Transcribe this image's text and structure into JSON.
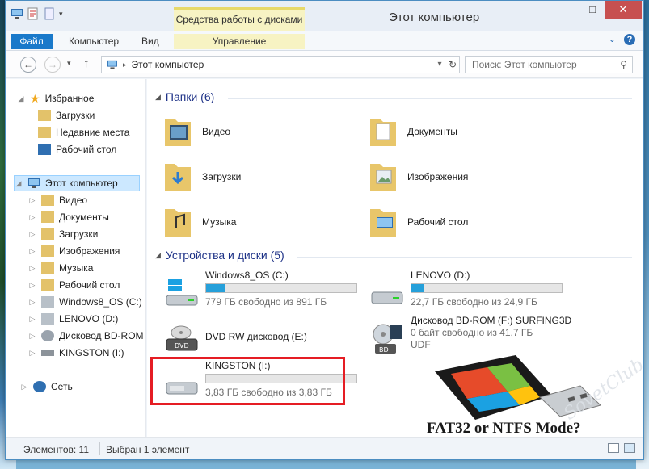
{
  "window": {
    "title": "Этот компьютер",
    "tools_tab_header": "Средства работы с дисками",
    "controls": [
      "—",
      "□",
      "✕"
    ]
  },
  "ribbon": {
    "tabs": [
      "Файл",
      "Компьютер",
      "Вид",
      "Управление"
    ]
  },
  "address": {
    "path": "Этот компьютер",
    "search_placeholder": "Поиск: Этот компьютер"
  },
  "nav_pane": {
    "favorites_label": "Избранное",
    "favorites": [
      "Загрузки",
      "Недавние места",
      "Рабочий стол"
    ],
    "computer_label": "Этот компьютер",
    "computer_items": [
      "Видео",
      "Документы",
      "Загрузки",
      "Изображения",
      "Музыка",
      "Рабочий стол",
      "Windows8_OS (C:)",
      "LENOVO (D:)",
      "Дисковод BD-ROM",
      "KINGSTON (I:)"
    ],
    "network_label": "Сеть"
  },
  "content": {
    "folders_header": "Папки (6)",
    "folders": [
      "Видео",
      "Документы",
      "Загрузки",
      "Изображения",
      "Музыка",
      "Рабочий стол"
    ],
    "devices_header": "Устройства и диски (5)",
    "drives": [
      {
        "name": "Windows8_OS (C:)",
        "info": "779 ГБ свободно из 891 ГБ",
        "used_fraction": 0.126
      },
      {
        "name": "LENOVO (D:)",
        "info": "22,7 ГБ свободно из 24,9 ГБ",
        "used_fraction": 0.088
      },
      {
        "name": "DVD RW дисковод (E:)",
        "info": "",
        "used_fraction": null
      },
      {
        "name": "Дисковод BD-ROM (F:) SURFING3D",
        "info": "0 байт свободно из 41,7 ГБ",
        "info2": "UDF",
        "used_fraction": null
      },
      {
        "name": "KINGSTON (I:)",
        "info": "3,83 ГБ свободно из 3,83 ГБ",
        "used_fraction": 0.0
      }
    ]
  },
  "status": {
    "items_count": "Элементов: 11",
    "selected": "Выбран 1 элемент"
  },
  "promo": {
    "caption": "FAT32 or NTFS Mode?",
    "watermark": "SovetClub"
  },
  "colors": {
    "accent": "#1979ca",
    "bar_fill": "#26a0da",
    "highlight": "#e51d24",
    "tools_tab": "#f7f3c3"
  }
}
